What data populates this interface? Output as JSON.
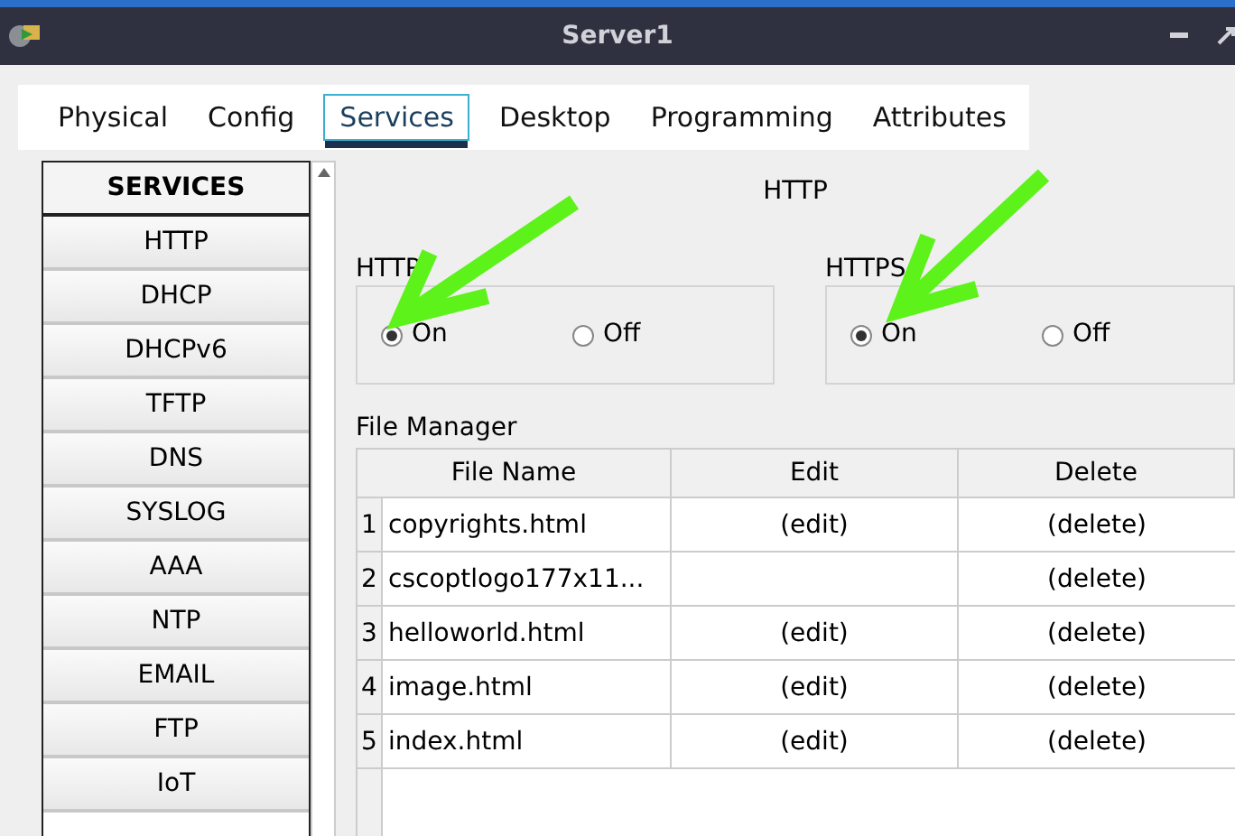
{
  "window": {
    "title": "Server1"
  },
  "tabs": [
    {
      "label": "Physical",
      "selected": false
    },
    {
      "label": "Config",
      "selected": false
    },
    {
      "label": "Services",
      "selected": true
    },
    {
      "label": "Desktop",
      "selected": false
    },
    {
      "label": "Programming",
      "selected": false
    },
    {
      "label": "Attributes",
      "selected": false
    }
  ],
  "sidebar": {
    "header": "SERVICES",
    "items": [
      {
        "label": "HTTP",
        "selected": false
      },
      {
        "label": "DHCP",
        "selected": false
      },
      {
        "label": "DHCPv6",
        "selected": false
      },
      {
        "label": "TFTP",
        "selected": false
      },
      {
        "label": "DNS",
        "selected": false
      },
      {
        "label": "SYSLOG",
        "selected": false
      },
      {
        "label": "AAA",
        "selected": false
      },
      {
        "label": "NTP",
        "selected": false
      },
      {
        "label": "EMAIL",
        "selected": false
      },
      {
        "label": "FTP",
        "selected": false
      },
      {
        "label": "IoT",
        "selected": false
      }
    ]
  },
  "panel": {
    "title": "HTTP",
    "groups": [
      {
        "label": "HTTP",
        "options": [
          {
            "label": "On",
            "selected": true
          },
          {
            "label": "Off",
            "selected": false
          }
        ]
      },
      {
        "label": "HTTPS",
        "options": [
          {
            "label": "On",
            "selected": true
          },
          {
            "label": "Off",
            "selected": false
          }
        ]
      }
    ]
  },
  "file_manager": {
    "label": "File Manager",
    "columns": [
      "File Name",
      "Edit",
      "Delete"
    ],
    "rows": [
      {
        "index": "1",
        "name": "copyrights.html",
        "edit": "(edit)",
        "delete": "(delete)"
      },
      {
        "index": "2",
        "name": "cscoptlogo177x11...",
        "delete": "(delete)"
      },
      {
        "index": "3",
        "name": "helloworld.html",
        "edit": "(edit)",
        "delete": "(delete)"
      },
      {
        "index": "4",
        "name": "image.html",
        "edit": "(edit)",
        "delete": "(delete)"
      },
      {
        "index": "5",
        "name": "index.html",
        "edit": "(edit)",
        "delete": "(delete)"
      }
    ]
  }
}
